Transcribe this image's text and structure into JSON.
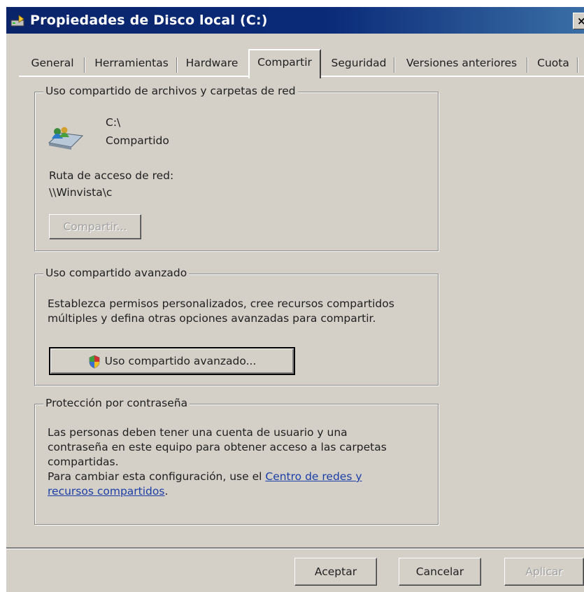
{
  "window": {
    "title": "Propiedades de Disco local (C:)",
    "close_glyph": "×"
  },
  "tabs": [
    {
      "label": "General"
    },
    {
      "label": "Herramientas"
    },
    {
      "label": "Hardware"
    },
    {
      "label": "Compartir",
      "active": true
    },
    {
      "label": "Seguridad"
    },
    {
      "label": "Versiones anteriores"
    },
    {
      "label": "Cuota"
    }
  ],
  "network_sharing": {
    "legend": "Uso compartido de archivos y carpetas de red",
    "drive_path": "C:\\",
    "status": "Compartido",
    "network_path_label": "Ruta de acceso de red:",
    "network_path": "\\\\Winvista\\c",
    "share_button": "Compartir..."
  },
  "advanced_sharing": {
    "legend": "Uso compartido avanzado",
    "description_line1": "Establezca permisos personalizados, cree recursos compartidos",
    "description_line2": "múltiples y defina otras opciones avanzadas para compartir.",
    "button": "Uso compartido avanzado..."
  },
  "password_protection": {
    "legend": "Protección por contraseña",
    "text_line1": "Las personas deben tener una cuenta de usuario y una",
    "text_line2": "contraseña en este equipo para obtener acceso a las carpetas",
    "text_line3": "compartidas.",
    "text_line4": "Para cambiar esta configuración, use el ",
    "link_part1": "Centro de redes y",
    "link_part2": "recursos compartidos",
    "text_end": "."
  },
  "footer": {
    "ok": "Aceptar",
    "cancel": "Cancelar",
    "apply": "Aplicar"
  },
  "colors": {
    "titlebar": "#0a246a",
    "dialog_face": "#d4d0c8",
    "link": "#1a3ea8"
  }
}
